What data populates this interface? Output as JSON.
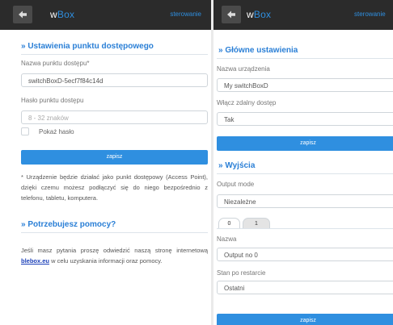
{
  "colors": {
    "accent": "#2f8fe0",
    "topbar": "#2b2b2b",
    "title": "#2a7fd6"
  },
  "left": {
    "header": {
      "back_icon": "arrow-left-icon",
      "logo_w": "w",
      "logo_box": "Box",
      "link": "sterowanie"
    },
    "access_point": {
      "title": "» Ustawienia punktu dostępowego",
      "name_label": "Nazwa punktu dostępu*",
      "name_value": "switchBoxD-5ecf7f84c14d",
      "password_label": "Hasło punktu dostępu",
      "password_placeholder": "8 - 32 znaków",
      "show_password_label": "Pokaż hasło",
      "save_label": "zapisz",
      "note": "* Urządzenie będzie działać jako punkt dostępowy (Access Point), dzięki czemu możesz podłączyć się do niego bezpośrednio z telefonu, tabletu, komputera."
    },
    "help": {
      "title": "» Potrzebujesz pomocy?",
      "text_before": "Jeśli masz pytania proszę odwiedzić naszą stronę internetową ",
      "link": "blebox.eu",
      "text_after": " w celu uzyskania informacji oraz pomocy."
    }
  },
  "right": {
    "header": {
      "back_icon": "arrow-left-icon",
      "logo_w": "w",
      "logo_box": "Box",
      "link": "sterowanie"
    },
    "main": {
      "title": "» Główne ustawienia",
      "device_name_label": "Nazwa urządzenia",
      "device_name_value": "My switchBoxD",
      "remote_label": "Włącz zdalny dostęp",
      "remote_value": "Tak",
      "save_label": "zapisz"
    },
    "outputs": {
      "title": "» Wyjścia",
      "mode_label": "Output mode",
      "mode_value": "Niezależne",
      "tabs": [
        "0",
        "1"
      ],
      "name_label": "Nazwa",
      "name_value": "Output no 0",
      "restart_label": "Stan po restarcie",
      "restart_value": "Ostatni",
      "save_label": "zapisz"
    }
  }
}
